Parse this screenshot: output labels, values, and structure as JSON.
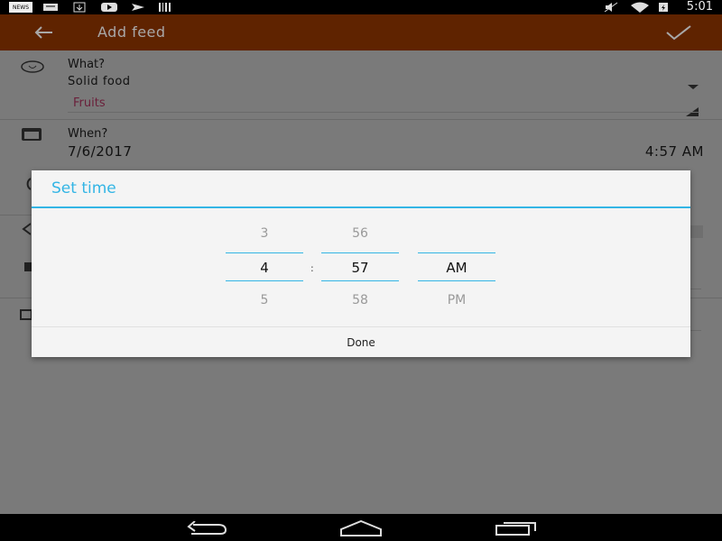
{
  "status_bar": {
    "time": "5:01",
    "left_icons": [
      "news-icon",
      "mail-icon",
      "download-icon",
      "youtube-icon",
      "send-icon",
      "barcode-icon"
    ],
    "right_icons": [
      "mute-icon",
      "wifi-icon",
      "battery-icon"
    ]
  },
  "app_bar": {
    "title": "Add feed",
    "back_icon": "back-arrow-icon",
    "confirm_icon": "check-icon"
  },
  "form": {
    "what_label": "What?",
    "what_value": "Solid food",
    "what_sub_value": "Fruits",
    "when_label": "When?",
    "date": "7/6/2017",
    "time": "4:57 AM"
  },
  "dialog": {
    "title": "Set time",
    "hour": {
      "prev": "3",
      "current": "4",
      "next": "5"
    },
    "separator": ":",
    "minute": {
      "prev": "56",
      "current": "57",
      "next": "58"
    },
    "ampm": {
      "prev": "",
      "current": "AM",
      "next": "PM"
    },
    "done_label": "Done"
  },
  "colors": {
    "accent": "#33b5e5",
    "app_bar": "#5f2300",
    "fruits_text": "#6a1f3a"
  }
}
